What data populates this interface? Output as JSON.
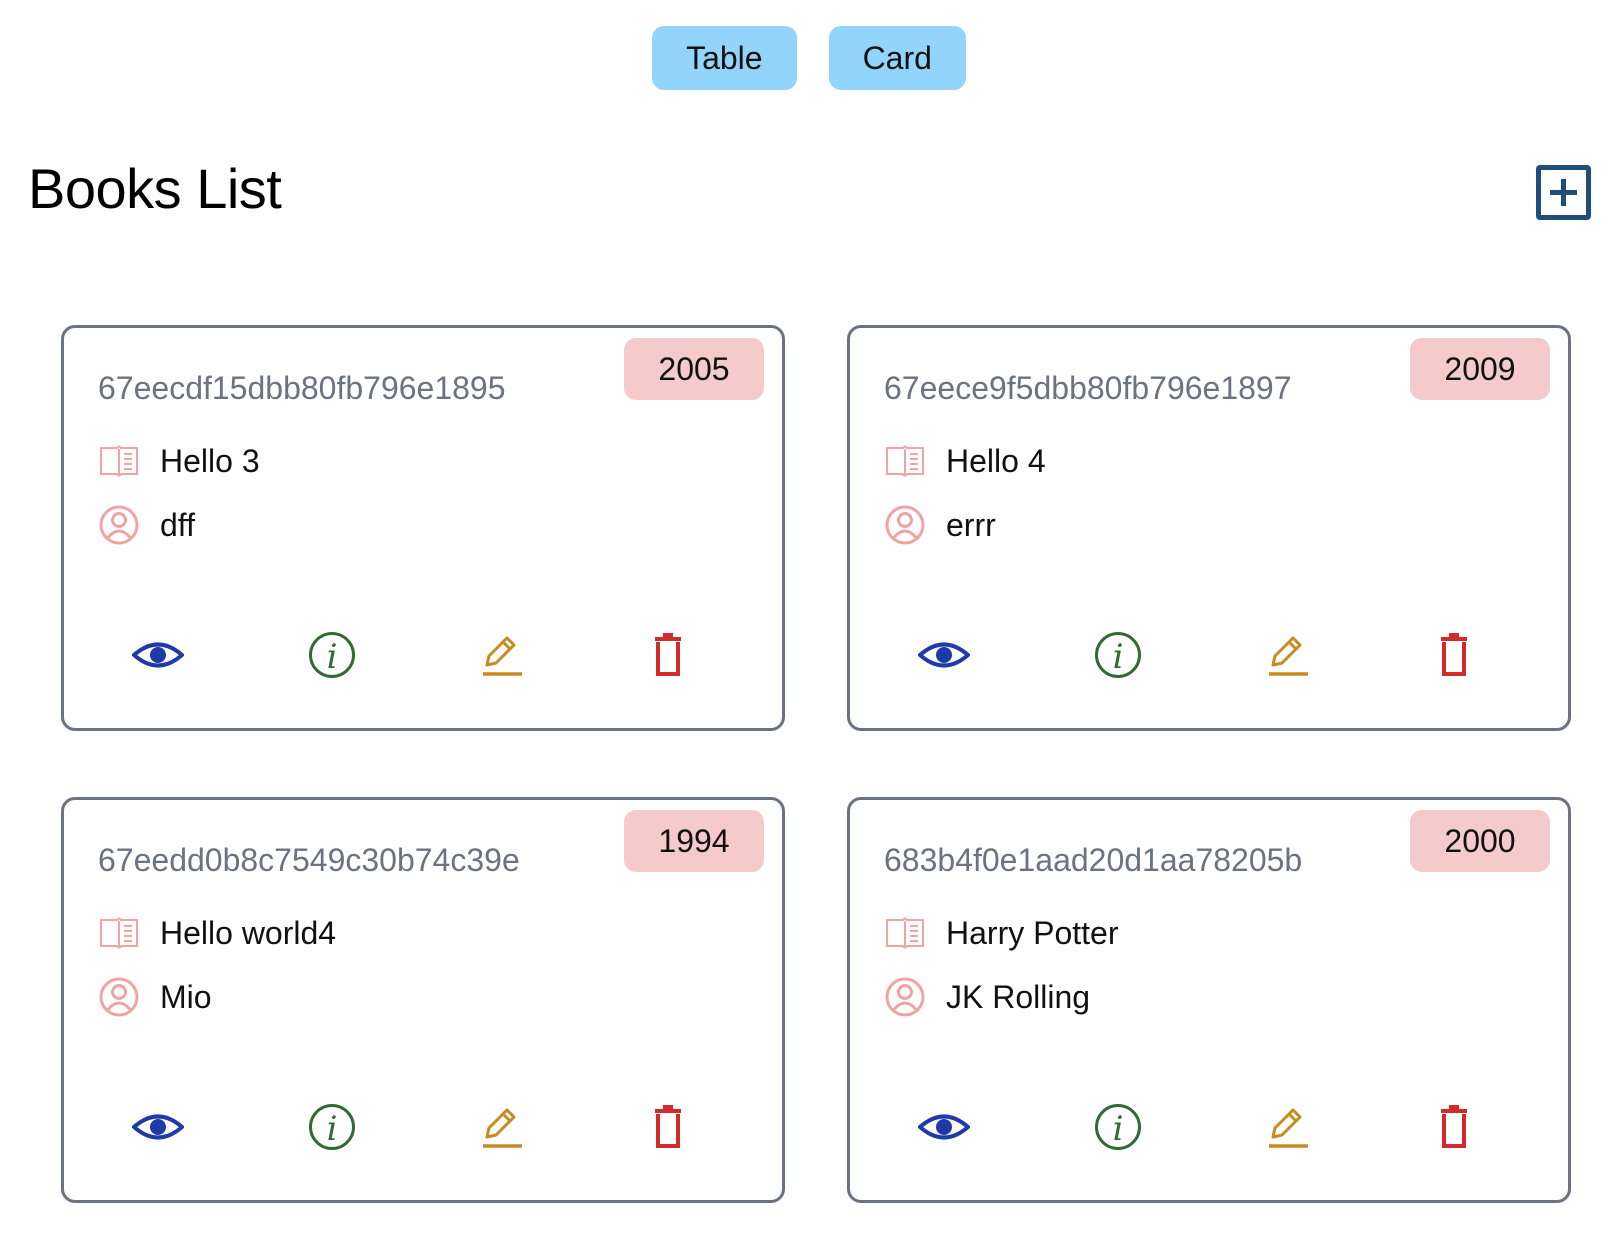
{
  "view_toggle": {
    "table_label": "Table",
    "card_label": "Card"
  },
  "header": {
    "title": "Books List",
    "add_icon": "plus-square-icon"
  },
  "colors": {
    "toggle_bg": "#93d5fa",
    "badge_bg": "#f5caca",
    "card_border": "#6b7280",
    "book_icon": "#f0a3a3",
    "view_icon": "#1e3aa8",
    "info_icon": "#2f6b33",
    "edit_icon": "#c98a1e",
    "delete_icon": "#d22b2b",
    "add_icon": "#1f4e79"
  },
  "card_icons": {
    "title_icon": "open-book-icon",
    "author_icon": "user-circle-icon",
    "view_icon": "eye-icon",
    "info_icon": "info-circle-icon",
    "edit_icon": "pencil-icon",
    "delete_icon": "trash-icon"
  },
  "books": [
    {
      "id": "67eecdf15dbb80fb796e1895",
      "year": "2005",
      "title": "Hello 3",
      "author": "dff"
    },
    {
      "id": "67eece9f5dbb80fb796e1897",
      "year": "2009",
      "title": "Hello 4",
      "author": "errr"
    },
    {
      "id": "67eedd0b8c7549c30b74c39e",
      "year": "1994",
      "title": "Hello world4",
      "author": "Mio"
    },
    {
      "id": "683b4f0e1aad20d1aa78205b",
      "year": "2000",
      "title": "Harry Potter",
      "author": "JK Rolling"
    }
  ]
}
